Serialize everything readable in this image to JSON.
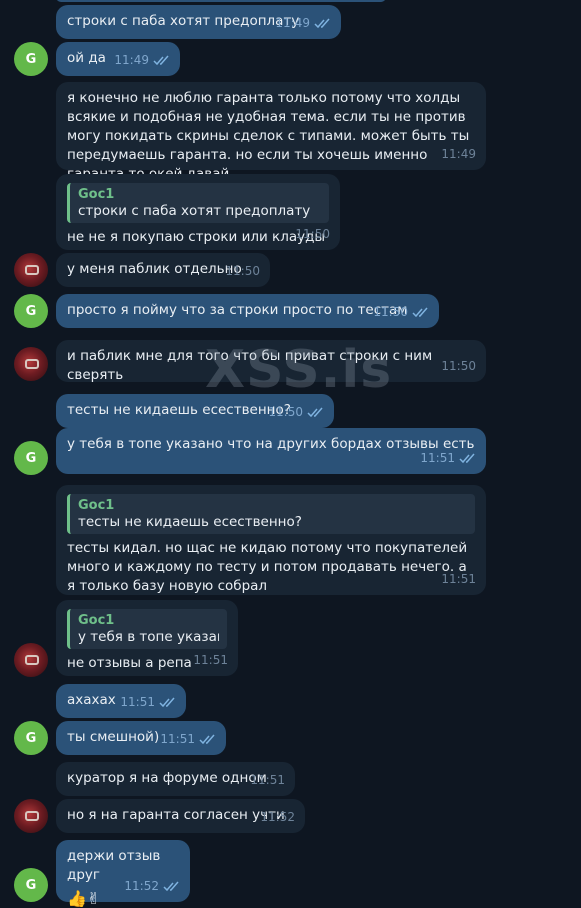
{
  "watermark": "XSS.is",
  "avatar_letter": "G",
  "messages": [
    {
      "side": "out",
      "text": "строки с паба хотят предоплату",
      "time": "11:49"
    },
    {
      "side": "out",
      "text": "ой да",
      "time": "11:49"
    },
    {
      "side": "in",
      "text": "я конечно не люблю гаранта только потому что холды всякие и подобная не удобная тема. если ты не против могу покидать скрины сделок с типами. может быть ты передумаешь гаранта. но если ты хочешь именно гаранта то окей давай",
      "time": "11:49"
    },
    {
      "side": "in",
      "quote_name": "Goc1",
      "quote_text": "строки с паба хотят предоплату",
      "text": "не не я покупаю строки или клауды",
      "time": "11:50"
    },
    {
      "side": "in",
      "text": "у меня паблик отдельно",
      "time": "11:50"
    },
    {
      "side": "out",
      "text": "просто я пойму что за строки просто по тестам",
      "time": "11:50"
    },
    {
      "side": "in",
      "text": "и паблик мне для того что бы приват строки с ним сверять",
      "time": "11:50"
    },
    {
      "side": "out",
      "text": "тесты не кидаешь есественно?",
      "time": "11:50"
    },
    {
      "side": "out",
      "text": "у тебя в топе указано что на других бордах отзывы есть",
      "time": "11:51"
    },
    {
      "side": "in",
      "quote_name": "Goc1",
      "quote_text": "тесты не кидаешь есественно?",
      "text": "тесты кидал. но щас не кидаю потому что покупателей много и каждому по тесту и потом продавать нечего. а я только базу новую собрал",
      "time": "11:51"
    },
    {
      "side": "in",
      "quote_name": "Goc1",
      "quote_text": "у тебя в топе указано...",
      "text": "не отзывы а репа",
      "time": "11:51"
    },
    {
      "side": "out",
      "text": "ахахах",
      "time": "11:51"
    },
    {
      "side": "out",
      "text": "ты смешной)",
      "time": "11:51"
    },
    {
      "side": "in",
      "text": "куратор я на форуме одном",
      "time": "11:51"
    },
    {
      "side": "in",
      "text": "но я на гаранта согласен учти",
      "time": "11:52"
    },
    {
      "side": "out",
      "text": "держи отзыв друг",
      "emoji": "👍✌",
      "time": "11:52"
    }
  ],
  "colors": {
    "bg": "#0e1621",
    "incoming": "#182533",
    "outgoing": "#2b5278",
    "accent": "#6fc08a",
    "avatar_green": "#63b84a"
  },
  "icons": {
    "read": "double-check-icon"
  }
}
